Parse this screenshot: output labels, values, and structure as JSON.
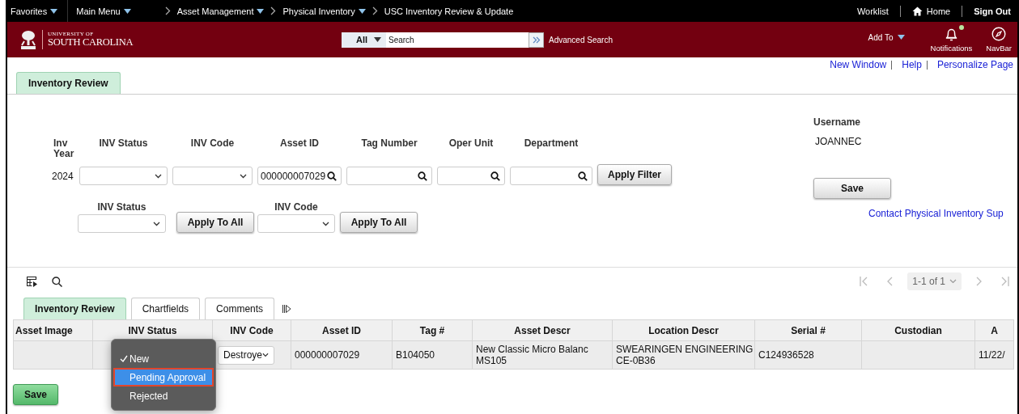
{
  "top_bar": {
    "menus": [
      {
        "label": "Favorites"
      },
      {
        "label": "Main Menu"
      }
    ],
    "breadcrumbs": [
      {
        "label": "Asset Management",
        "dropdown": true
      },
      {
        "label": "Physical Inventory",
        "dropdown": true
      },
      {
        "label": "USC Inventory Review & Update",
        "dropdown": false
      }
    ],
    "links": [
      {
        "label": "Worklist",
        "kind": "plain"
      },
      {
        "label": "Home",
        "kind": "home"
      },
      {
        "label": "Sign Out",
        "kind": "bold"
      }
    ]
  },
  "header": {
    "logo": {
      "line_1": "UNIVERSITY OF",
      "line_2": "SOUTH CAROLINA"
    },
    "search": {
      "scope": "All",
      "placeholder": "Search",
      "advanced": "Advanced Search"
    },
    "add_to": "Add To",
    "notifications": {
      "label": "Notifications",
      "unread": true
    },
    "navbar": "NavBar"
  },
  "utility_links": [
    "New Window",
    "Help",
    "Personalize Page"
  ],
  "page_tabs": [
    {
      "label": "Inventory Review",
      "selected": true
    }
  ],
  "filters": {
    "fields": [
      {
        "label": "Inv Year",
        "kind": "text",
        "value": "2024"
      },
      {
        "label": "INV Status",
        "kind": "select"
      },
      {
        "label": "INV Code",
        "kind": "select"
      },
      {
        "label": "Asset ID",
        "kind": "lookup",
        "value": "000000007029"
      },
      {
        "label": "Tag Number",
        "kind": "lookup"
      },
      {
        "label": "Oper Unit",
        "kind": "lookup"
      },
      {
        "label": "Department",
        "kind": "lookup"
      }
    ],
    "apply_button": "Apply Filter"
  },
  "mass_update": [
    {
      "label": "INV Status",
      "button": "Apply To All"
    },
    {
      "label": "INV Code",
      "button": "Apply To All"
    }
  ],
  "user": {
    "label": "Username",
    "value": "JOANNEC",
    "save": "Save",
    "contact_link": "Contact Physical Inventory Sup"
  },
  "grid": {
    "pagination": "1-1 of 1",
    "tabs": [
      {
        "label": "Inventory Review",
        "selected": true
      },
      {
        "label": "Chartfields",
        "selected": false
      },
      {
        "label": "Comments",
        "selected": false
      }
    ],
    "columns": [
      "Asset Image",
      "INV Status",
      "INV Code",
      "Asset ID",
      "Tag #",
      "Asset Descr",
      "Location Descr",
      "Serial #",
      "Custodian",
      "A"
    ],
    "rows": [
      {
        "cells": [
          {
            "kind": "empty"
          },
          {
            "kind": "empty"
          },
          {
            "kind": "select",
            "value": "Destroye"
          },
          {
            "kind": "text",
            "lines": [
              "000000007029"
            ]
          },
          {
            "kind": "text",
            "lines": [
              "B104050"
            ]
          },
          {
            "kind": "text",
            "lines": [
              "New Classic Micro Balanc",
              "MS105"
            ]
          },
          {
            "kind": "text",
            "lines": [
              "SWEARINGEN ENGINEERING",
              "CE-0B36"
            ]
          },
          {
            "kind": "text",
            "lines": [
              "C124936528"
            ]
          },
          {
            "kind": "empty"
          },
          {
            "kind": "text",
            "lines": [
              "11/22/"
            ]
          }
        ]
      }
    ]
  },
  "status_menu": {
    "options": [
      {
        "label": "New",
        "checked": true,
        "selected": false,
        "outlined": false
      },
      {
        "label": "Pending Approval",
        "checked": false,
        "selected": true,
        "outlined": true
      },
      {
        "label": "Rejected",
        "checked": false,
        "selected": false,
        "outlined": false
      }
    ]
  },
  "save_button": "Save"
}
